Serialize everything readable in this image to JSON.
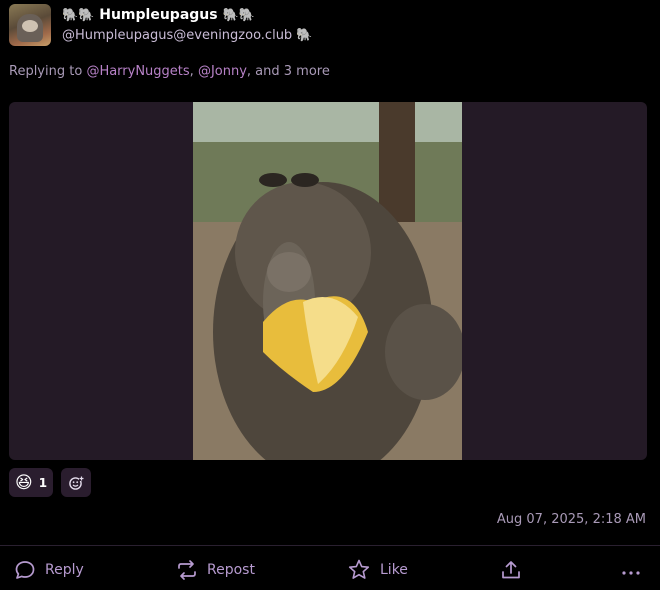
{
  "post": {
    "display_name": "Humpleupagus",
    "name_emoji": "🐘🐘",
    "handle": "@Humpleupagus@eveningzoo.club",
    "handle_emoji": "🐘",
    "replying_prefix": "Replying to",
    "mention_1": "@HarryNuggets",
    "separator": ",",
    "mention_2": "@Jonny",
    "replying_suffix": ", and 3 more",
    "image_alt": "",
    "timestamp": "Aug 07, 2025, 2:18 AM"
  },
  "reactions": [
    {
      "emoji": "😆",
      "count": "1"
    }
  ],
  "actions": {
    "reply": "Reply",
    "repost": "Repost",
    "like": "Like"
  },
  "colors": {
    "background": "#000000",
    "accent": "#b79bd0",
    "mention": "#b882c8",
    "media_bg": "#241a26"
  }
}
